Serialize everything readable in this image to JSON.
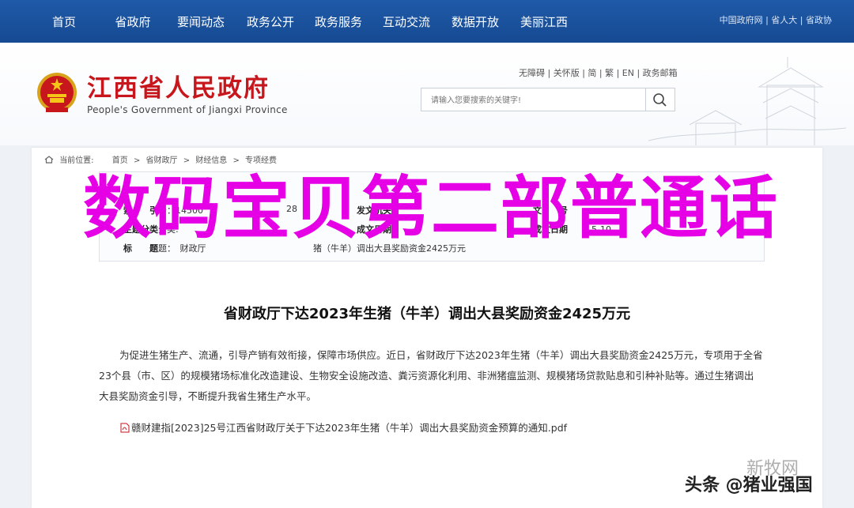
{
  "nav": {
    "items": [
      "首页",
      "省政府",
      "要闻动态",
      "政务公开",
      "政务服务",
      "互动交流",
      "数据开放",
      "美丽江西"
    ],
    "right_links": "中国政府网 | 省人大 | 省政协"
  },
  "header": {
    "title": "江西省人民政府",
    "subtitle": "People's Government of Jiangxi Province",
    "util_links": "无障碍 | 关怀版 | 简 | 繁 | EN | 政务邮箱",
    "search_placeholder": "请输入您要搜索的关键字!"
  },
  "breadcrumb": {
    "label": "当前位置:",
    "items": [
      "首页",
      ">",
      "省财政厅",
      ">",
      "财经信息",
      ">",
      "专项经费"
    ]
  },
  "meta": {
    "index_label": "索　　引",
    "index_value": "号：14500",
    "index_tail": "28",
    "issuer_label": "发文机关",
    "doc_label": "文　　号",
    "category_label": "主题分类",
    "category_value": "分类:",
    "date_label": "成文日期",
    "date_value": "5-10",
    "title_label": "标　　题",
    "title_value": "题：　财政厅",
    "title_tail": "猪（牛羊）调出大县奖励资金2425万元"
  },
  "article": {
    "title": "省财政厅下达2023年生猪（牛羊）调出大县奖励资金2425万元",
    "body": "为促进生猪生产、流通，引导产销有效衔接，保障市场供应。近日，省财政厅下达2023年生猪（牛羊）调出大县奖励资金2425万元，专项用于全省23个县（市、区）的规模猪场标准化改造建设、生物安全设施改造、粪污资源化利用、非洲猪瘟监测、规模猪场贷款贴息和引种补贴等。通过生猪调出大县奖励资金引导，不断提升我省生猪生产水平。",
    "attachment": "赣财建指[2023]25号江西省财政厅关于下达2023年生猪（牛羊）调出大县奖励资金预算的通知.pdf"
  },
  "overlay": {
    "text": "数码宝贝第二部普通话"
  },
  "watermarks": {
    "top": "新牧网",
    "bottom": "头条 @猪业强国"
  },
  "colors": {
    "nav_bg": "#1f5aa8",
    "title_red": "#c8161d",
    "overlay_magenta": "#e600e6"
  }
}
